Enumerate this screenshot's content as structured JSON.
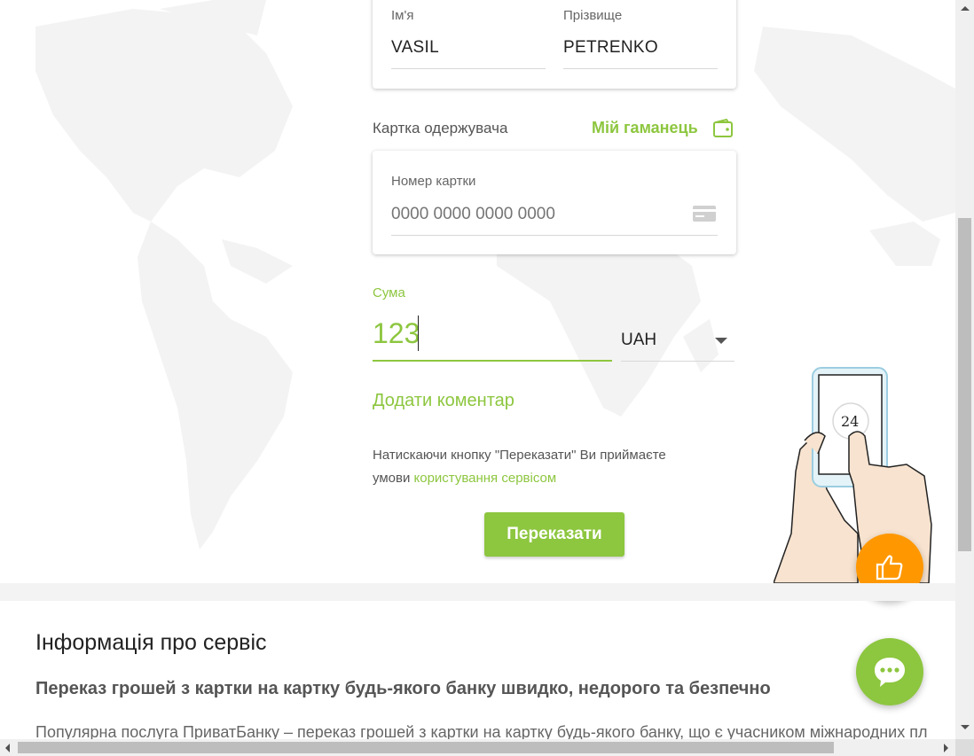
{
  "form": {
    "name": {
      "first_label": "Ім'я",
      "first_value": "VASIL",
      "last_label": "Прізвище",
      "last_value": "PETRENKO"
    },
    "recipient": {
      "section_label": "Картка одержувача",
      "wallet_link": "Мій гаманець",
      "card_label": "Номер картки",
      "card_placeholder": "0000 0000 0000 0000"
    },
    "amount": {
      "label": "Сума",
      "value": "123",
      "currency": "UAH"
    },
    "add_comment": "Додати коментар",
    "terms": {
      "line1": "Натискаючи кнопку \"Переказати\" Ви приймаєте",
      "line2_prefix": "умови ",
      "link": "користування сервісом"
    },
    "submit_label": "Переказати"
  },
  "illustration": {
    "badge": "24"
  },
  "info": {
    "title": "Інформація про сервіс",
    "subtitle": "Переказ грошей з картки на картку будь-якого банку швидко, недорого та безпечно",
    "text": "Популярна послуга ПриватБанку – переказ грошей з картки на картку будь-якого банку, що є учасником міжнародних пл"
  },
  "colors": {
    "accent": "#8dc63f",
    "orange": "#ff9800",
    "text": "#222222",
    "muted": "#666666"
  },
  "icons": {
    "wallet": "wallet-icon",
    "card": "credit-card-icon",
    "dropdown": "caret-down-icon",
    "like": "thumbs-up-icon",
    "chat": "chat-bubble-icon"
  }
}
